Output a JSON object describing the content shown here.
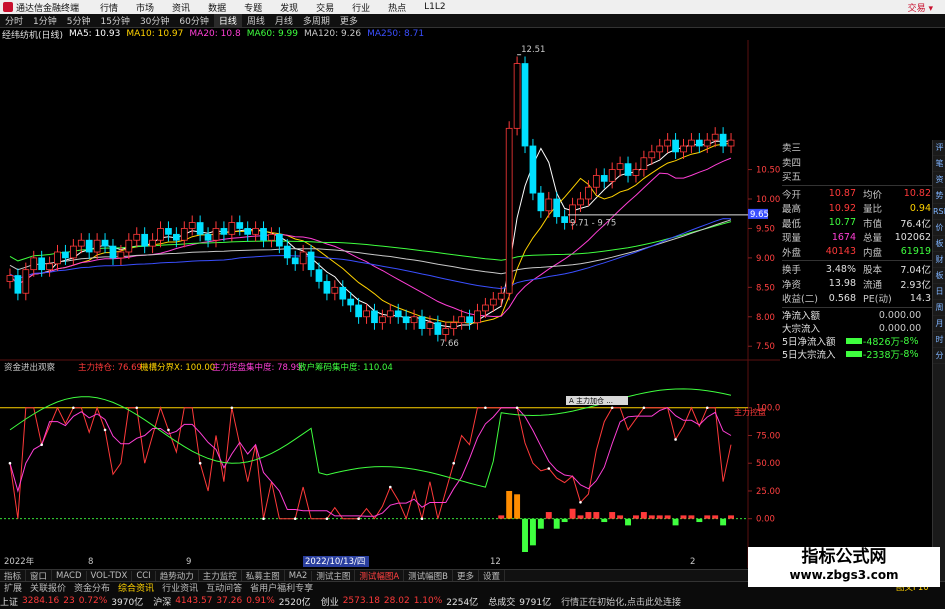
{
  "titlebar": {
    "app_name": "通达信金融终端",
    "menu": [
      "行情",
      "市场",
      "资讯",
      "数据",
      "专题",
      "发现",
      "交易",
      "行业",
      "热点",
      "L1L2"
    ],
    "right_link": "交易 ▾"
  },
  "periods": [
    "分时",
    "1分钟",
    "5分钟",
    "15分钟",
    "30分钟",
    "60分钟",
    "日线",
    "周线",
    "月线",
    "多周期",
    "更多"
  ],
  "active_period": "日线",
  "ma": {
    "stock": "经纬纺机(日线)",
    "items": [
      {
        "label": "MA5: 10.93",
        "color": "#ffffff"
      },
      {
        "label": "MA10: 10.97",
        "color": "#ffd200"
      },
      {
        "label": "MA20: 10.8",
        "color": "#ff3fd6"
      },
      {
        "label": "MA60: 9.99",
        "color": "#3fff3f"
      },
      {
        "label": "MA120: 9.26",
        "color": "#c8c8c8"
      },
      {
        "label": "MA250: 8.71",
        "color": "#3a4fff"
      }
    ]
  },
  "chart_data": [
    {
      "type": "candlestick",
      "title": "经纬纺机(日线)",
      "price_axis": {
        "ticks": [
          "10.50",
          "10.00",
          "9.50",
          "9.00",
          "8.50",
          "8.00",
          "7.50"
        ],
        "ylim": [
          7.3,
          12.7
        ]
      },
      "annotations": [
        {
          "text": "12.51",
          "kind": "high"
        },
        {
          "text": "7.66",
          "kind": "low"
        },
        {
          "text": "9.71 - 9.75",
          "kind": "gap"
        },
        {
          "text": "9.65",
          "kind": "price-marker"
        }
      ],
      "close_series": [
        8.7,
        8.4,
        8.8,
        9.0,
        8.8,
        8.9,
        9.1,
        9.0,
        9.2,
        9.3,
        9.1,
        9.3,
        9.2,
        9.0,
        9.1,
        9.3,
        9.4,
        9.2,
        9.3,
        9.5,
        9.4,
        9.3,
        9.5,
        9.6,
        9.4,
        9.3,
        9.5,
        9.4,
        9.6,
        9.5,
        9.4,
        9.5,
        9.3,
        9.4,
        9.2,
        9.0,
        8.9,
        9.1,
        8.8,
        8.6,
        8.4,
        8.5,
        8.3,
        8.2,
        8.0,
        8.1,
        7.9,
        8.0,
        8.1,
        8.0,
        7.9,
        8.0,
        7.8,
        7.9,
        7.7,
        7.8,
        7.9,
        8.0,
        7.9,
        8.1,
        8.2,
        8.3,
        8.4,
        11.2,
        12.3,
        10.9,
        10.1,
        9.8,
        10.0,
        9.7,
        9.6,
        9.9,
        10.0,
        10.2,
        10.4,
        10.3,
        10.5,
        10.6,
        10.4,
        10.5,
        10.7,
        10.8,
        10.9,
        11.0,
        10.8,
        10.9,
        11.0,
        10.9,
        11.0,
        11.1,
        10.9,
        11.0
      ]
    },
    {
      "type": "line",
      "title": "资金进出观察",
      "legend": [
        {
          "name": "主力持仓: 76.69",
          "color": "#ff3a3a"
        },
        {
          "name": "機構分界X: 100.00",
          "color": "#ffd200"
        },
        {
          "name": "主力控盘集中度: 78.99",
          "color": "#ff3fd6"
        },
        {
          "name": "散户筹码集中度: 110.04",
          "color": "#3fff3f"
        }
      ],
      "y_axis": {
        "ticks": [
          "100.0",
          "75.00",
          "50.00",
          "25.00",
          "0.00"
        ],
        "ylim": [
          -30,
          125
        ]
      },
      "annotation": "主力控盘",
      "marker_label": "A 主力加仓 ...",
      "x_labels": [
        "2022年",
        "8",
        "9",
        "2022/10/13/四",
        "12",
        "2"
      ]
    }
  ],
  "quote": {
    "top": [
      "卖三",
      "卖四",
      "买五"
    ],
    "rows": [
      [
        "今开",
        "10.87",
        "均价",
        "10.82"
      ],
      [
        "最高",
        "10.92",
        "量比",
        "0.94"
      ],
      [
        "最低",
        "10.77",
        "市值",
        "76.4亿"
      ],
      [
        "现量",
        "1674",
        "总量",
        "102062"
      ],
      [
        "外盘",
        "40143",
        "内盘",
        "61919"
      ],
      [
        "换手",
        "3.48%",
        "股本",
        "7.04亿"
      ],
      [
        "净资",
        "13.98",
        "流通",
        "2.93亿"
      ],
      [
        "收益(二)",
        "0.568",
        "PE(动)",
        "14.3"
      ]
    ],
    "flow": [
      {
        "label": "净流入额",
        "value": "0.00",
        "unit": "0.00",
        "bar": ""
      },
      {
        "label": "大宗流入",
        "value": "0.00",
        "unit": "0.00",
        "bar": ""
      },
      {
        "label": "5日净流入额",
        "value": "-4826万",
        "unit": "-8%",
        "bar": "#3fff3f"
      },
      {
        "label": "5日大宗流入",
        "value": "-2338万",
        "unit": "-8%",
        "bar": "#3fff3f"
      }
    ]
  },
  "right_tabs": [
    "评",
    "笔",
    "资",
    "势",
    "RSI",
    "价",
    "板",
    "财",
    "板",
    "日",
    "周",
    "月",
    "时",
    "分"
  ],
  "indicator_tabs": [
    "指标",
    "窗口",
    "MACD",
    "VOL-TDX",
    "CCI",
    "趋势动力",
    "主力监控",
    "私募主图",
    "MA2",
    "测试主图",
    "测试幅图A",
    "测试幅图B",
    "更多",
    "设置"
  ],
  "active_indicator": "测试幅图A",
  "bottom_tabs": [
    "扩展",
    "关联报价",
    "资金分布",
    "综合资讯",
    "行业资讯",
    "互动问答",
    "省用户福利专享"
  ],
  "bottom_hl": "综合资讯",
  "bottom_right": "图文F10",
  "indices": [
    {
      "name": "上证",
      "price": "3284.16",
      "chg": "23",
      "pct": "0.72%",
      "vol": "3970亿"
    },
    {
      "name": "沪深",
      "price": "4143.57",
      "chg": "37.26",
      "pct": "0.91%",
      "vol": "2520亿"
    },
    {
      "name": "创业",
      "price": "2573.18",
      "chg": "28.02",
      "pct": "1.10%",
      "vol": "2254亿"
    }
  ],
  "total_turnover_label": "总成交",
  "total_turnover": "9791亿",
  "status_message": "行情正在初始化,点击此处连接",
  "watermark": {
    "line1": "指标公式网",
    "line2": "www.zbgs3.com"
  },
  "colors": {
    "up": "#ff3a3a",
    "down": "#00e0ff",
    "green": "#3fff3f",
    "yellow": "#ffd200"
  }
}
